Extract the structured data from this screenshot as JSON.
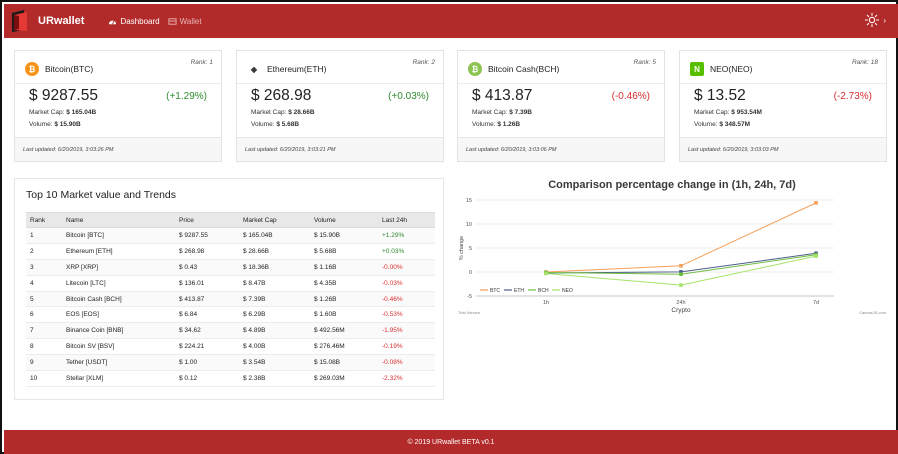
{
  "app": {
    "brand": "URwallet"
  },
  "nav": [
    {
      "label": "Dashboard",
      "icon": "dashboard-icon",
      "active": true
    },
    {
      "label": "Wallet",
      "icon": "wallet-icon",
      "active": false
    }
  ],
  "colors": {
    "brand": "#b22a2a",
    "positive": "#2e8b2e",
    "negative": "#d62d2d"
  },
  "cards": [
    {
      "name": "Bitcoin(BTC)",
      "rank": "Rank: 1",
      "price": "$ 9287.55",
      "change": "(+1.29%)",
      "trend": "up",
      "market_cap_label": "Market Cap:",
      "market_cap": "$ 165.04B",
      "volume_label": "Volume:",
      "volume": "$ 15.90B",
      "updated": "Last updated: 6/20/2019, 3:03:26 PM",
      "icon": "bitcoin-icon",
      "icon_color": "#f7931a",
      "glyph": "₿"
    },
    {
      "name": "Ethereum(ETH)",
      "rank": "Rank: 2",
      "price": "$ 268.98",
      "change": "(+0.03%)",
      "trend": "up",
      "market_cap_label": "Market Cap:",
      "market_cap": "$ 28.66B",
      "volume_label": "Volume:",
      "volume": "$ 5.68B",
      "updated": "Last updated: 6/20/2019, 3:03:21 PM",
      "icon": "ethereum-icon",
      "icon_color": "#3c3c3d",
      "glyph": "◆"
    },
    {
      "name": "Bitcoin Cash(BCH)",
      "rank": "Rank: 5",
      "price": "$ 413.87",
      "change": "(-0.46%)",
      "trend": "down",
      "market_cap_label": "Market Cap:",
      "market_cap": "$ 7.39B",
      "volume_label": "Volume:",
      "volume": "$ 1.26B",
      "updated": "Last updated: 6/20/2019, 3:03:06 PM",
      "icon": "bitcoin-cash-icon",
      "icon_color": "#8dc351",
      "glyph": "₿"
    },
    {
      "name": "NEO(NEO)",
      "rank": "Rank: 18",
      "price": "$ 13.52",
      "change": "(-2.73%)",
      "trend": "down",
      "market_cap_label": "Market Cap:",
      "market_cap": "$ 953.54M",
      "volume_label": "Volume:",
      "volume": "$ 348.57M",
      "updated": "Last updated: 6/20/2019, 3:03:03 PM",
      "icon": "neo-icon",
      "icon_color": "#58bf00",
      "glyph": "N"
    }
  ],
  "top10": {
    "title": "Top 10 Market value and Trends",
    "columns": [
      "Rank",
      "Name",
      "Price",
      "Market Cap",
      "Volume",
      "Last 24h"
    ],
    "rows": [
      {
        "rank": "1",
        "name": "Bitcoin [BTC]",
        "price": "$ 9287.55",
        "cap": "$ 165.04B",
        "volume": "$ 15.90B",
        "last24h": "+1.29%",
        "trend": "up"
      },
      {
        "rank": "2",
        "name": "Ethereum [ETH]",
        "price": "$ 268.98",
        "cap": "$ 28.66B",
        "volume": "$ 5.68B",
        "last24h": "+0.03%",
        "trend": "up"
      },
      {
        "rank": "3",
        "name": "XRP [XRP]",
        "price": "$ 0.43",
        "cap": "$ 18.36B",
        "volume": "$ 1.16B",
        "last24h": "-0.00%",
        "trend": "down"
      },
      {
        "rank": "4",
        "name": "Litecoin [LTC]",
        "price": "$ 136.01",
        "cap": "$ 8.47B",
        "volume": "$ 4.35B",
        "last24h": "-0.03%",
        "trend": "down"
      },
      {
        "rank": "5",
        "name": "Bitcoin Cash [BCH]",
        "price": "$ 413.87",
        "cap": "$ 7.39B",
        "volume": "$ 1.26B",
        "last24h": "-0.46%",
        "trend": "down"
      },
      {
        "rank": "6",
        "name": "EOS [EOS]",
        "price": "$ 6.84",
        "cap": "$ 6.29B",
        "volume": "$ 1.60B",
        "last24h": "-0.53%",
        "trend": "down"
      },
      {
        "rank": "7",
        "name": "Binance Coin [BNB]",
        "price": "$ 34.62",
        "cap": "$ 4.89B",
        "volume": "$ 492.56M",
        "last24h": "-1.95%",
        "trend": "down"
      },
      {
        "rank": "8",
        "name": "Bitcoin SV [BSV]",
        "price": "$ 224.21",
        "cap": "$ 4.00B",
        "volume": "$ 276.46M",
        "last24h": "-0.19%",
        "trend": "down"
      },
      {
        "rank": "9",
        "name": "Tether [USDT]",
        "price": "$ 1.00",
        "cap": "$ 3.54B",
        "volume": "$ 15.08B",
        "last24h": "-0.08%",
        "trend": "down"
      },
      {
        "rank": "10",
        "name": "Stellar [XLM]",
        "price": "$ 0.12",
        "cap": "$ 2.38B",
        "volume": "$ 269.03M",
        "last24h": "-2.32%",
        "trend": "down"
      }
    ]
  },
  "chart_data": {
    "type": "line",
    "title": "Comparison percentage change in (1h, 24h, 7d)",
    "xlabel": "Crypto",
    "ylabel": "% change",
    "categories": [
      "1h",
      "24h",
      "7d"
    ],
    "ylim": [
      -5,
      15
    ],
    "yticks": [
      -5,
      0,
      5,
      10,
      15
    ],
    "grid": "horizontal",
    "legend": "bottom-left",
    "series": [
      {
        "name": "BTC",
        "values": [
          0.0,
          1.29,
          14.4
        ],
        "color": "#f4a05a"
      },
      {
        "name": "ETH",
        "values": [
          -0.2,
          0.03,
          3.9
        ],
        "color": "#4e5d8c"
      },
      {
        "name": "BCH",
        "values": [
          -0.1,
          -0.46,
          3.6
        ],
        "color": "#6fbf3f"
      },
      {
        "name": "NEO",
        "values": [
          -0.3,
          -2.73,
          3.3
        ],
        "color": "#a6e36a"
      }
    ],
    "watermark_left": "Trial Version",
    "watermark_right": "CanvasJS.com"
  },
  "footer": {
    "text": "© 2019 URwallet BETA v0.1"
  }
}
